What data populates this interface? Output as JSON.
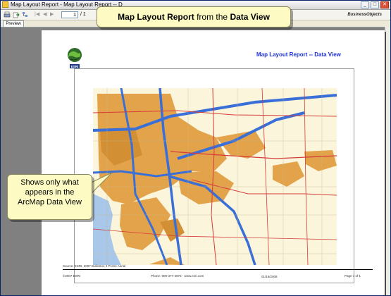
{
  "window": {
    "title": "Map Layout Report - Map Layout Report -- D",
    "buttons": [
      "minimize",
      "maximize",
      "close"
    ]
  },
  "toolbar": {
    "page_value": "1",
    "page_total": "/ 1",
    "brand": "BusinessObjects"
  },
  "tabs": [
    {
      "label": "Preview"
    }
  ],
  "report": {
    "title": "Map Layout Report -- Data View",
    "logo_text": "ESRI",
    "footer": {
      "source": "Source: ESRI, 2007 Bulleston 2 Protre Aerial",
      "copyright": "©2007 ESRI",
      "phone": "Phone: 909-377-4875 - www.esri.com",
      "date": "01/16/2008",
      "page": "Page 1 of 1"
    }
  },
  "callouts": {
    "top": {
      "prefix": "Map Layout Report",
      "middle": " from the ",
      "suffix": "Data View"
    },
    "side": {
      "lines": [
        "Shows only what",
        "appears in the",
        "ArcMap Data View"
      ]
    }
  },
  "colors": {
    "callout_bg": "#fdfbc3",
    "title_blue": "#1a2fd4",
    "map_urban": "#e3a34a",
    "map_background": "#fbf5dc",
    "water": "#a9c7e8",
    "highway": "#3a6fd8",
    "road": "#d63a3a"
  }
}
